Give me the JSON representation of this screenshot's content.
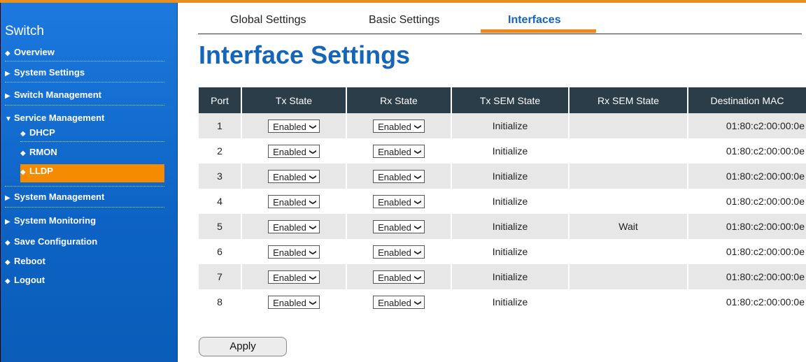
{
  "sidebar": {
    "title": "Switch",
    "items": [
      {
        "marker": "◆",
        "label": "Overview"
      },
      {
        "marker": "▶",
        "label": "System Settings"
      },
      {
        "marker": "▶",
        "label": "Switch Management"
      },
      {
        "marker": "▼",
        "label": "Service Management"
      },
      {
        "marker": "◆",
        "label": "DHCP"
      },
      {
        "marker": "◆",
        "label": "RMON"
      },
      {
        "marker": "◆",
        "label": "LLDP"
      },
      {
        "marker": "▶",
        "label": "System Management"
      },
      {
        "marker": "▶",
        "label": "System Monitoring"
      },
      {
        "marker": "◆",
        "label": "Save Configuration"
      },
      {
        "marker": "◆",
        "label": "Reboot"
      },
      {
        "marker": "◆",
        "label": "Logout"
      }
    ],
    "active_item": "LLDP"
  },
  "tabs": [
    {
      "label": "Global Settings"
    },
    {
      "label": "Basic Settings"
    },
    {
      "label": "Interfaces"
    }
  ],
  "active_tab": "Interfaces",
  "page_title": "Interface Settings",
  "table": {
    "headers": [
      "Port",
      "Tx State",
      "Rx State",
      "Tx SEM State",
      "Rx SEM State",
      "Destination MAC"
    ],
    "rows": [
      {
        "port": "1",
        "tx_state": "Enabled",
        "rx_state": "Enabled",
        "tx_sem": "Initialize",
        "rx_sem": "",
        "mac": "01:80:c2:00:00:0e"
      },
      {
        "port": "2",
        "tx_state": "Enabled",
        "rx_state": "Enabled",
        "tx_sem": "Initialize",
        "rx_sem": "",
        "mac": "01:80:c2:00:00:0e"
      },
      {
        "port": "3",
        "tx_state": "Enabled",
        "rx_state": "Enabled",
        "tx_sem": "Initialize",
        "rx_sem": "",
        "mac": "01:80:c2:00:00:0e"
      },
      {
        "port": "4",
        "tx_state": "Enabled",
        "rx_state": "Enabled",
        "tx_sem": "Initialize",
        "rx_sem": "",
        "mac": "01:80:c2:00:00:0e"
      },
      {
        "port": "5",
        "tx_state": "Enabled",
        "rx_state": "Enabled",
        "tx_sem": "Initialize",
        "rx_sem": "Wait",
        "mac": "01:80:c2:00:00:0e"
      },
      {
        "port": "6",
        "tx_state": "Enabled",
        "rx_state": "Enabled",
        "tx_sem": "Initialize",
        "rx_sem": "",
        "mac": "01:80:c2:00:00:0e"
      },
      {
        "port": "7",
        "tx_state": "Enabled",
        "rx_state": "Enabled",
        "tx_sem": "Initialize",
        "rx_sem": "",
        "mac": "01:80:c2:00:00:0e"
      },
      {
        "port": "8",
        "tx_state": "Enabled",
        "rx_state": "Enabled",
        "tx_sem": "Initialize",
        "rx_sem": "",
        "mac": "01:80:c2:00:00:0e"
      }
    ]
  },
  "apply_label": "Apply",
  "colors": {
    "sidebar_blue": "#0d63c4",
    "accent_orange": "#f58b00",
    "title_blue": "#1565b8",
    "header_dark": "#2b3d49"
  }
}
